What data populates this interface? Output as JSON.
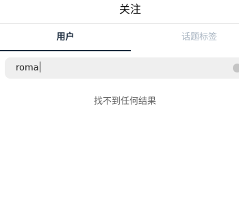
{
  "header": {
    "title": "关注"
  },
  "tabs": [
    {
      "label": "用户",
      "active": true
    },
    {
      "label": "话题标签",
      "active": false
    }
  ],
  "search": {
    "value": "roma"
  },
  "results": {
    "empty_message": "找不到任何结果"
  },
  "colors": {
    "active_tab": "#1c2c3f",
    "inactive_tab": "#a9b5c2",
    "search_bg": "#efefef",
    "divider": "#e8e8e8"
  }
}
